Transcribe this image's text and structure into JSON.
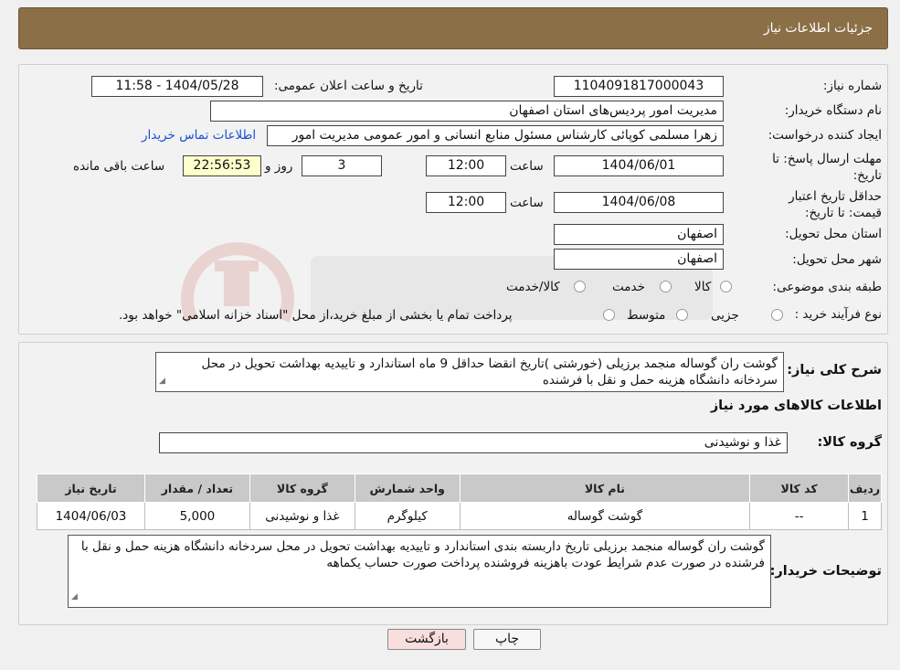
{
  "header": {
    "title": "جزئیات اطلاعات نیاز"
  },
  "fields": {
    "need_number_label": "شماره نیاز:",
    "need_number": "1104091817000043",
    "announce_label": "تاریخ و ساعت اعلان عمومی:",
    "announce_value": "1404/05/28 - 11:58",
    "buyer_org_label": "نام دستگاه خریدار:",
    "buyer_org": "مدیریت امور پردیس‌های استان اصفهان",
    "creator_label": "ایجاد کننده درخواست:",
    "creator": "زهرا مسلمی کوپائی کارشناس مسئول منابع انسانی و امور عمومی مدیریت امور",
    "contact_link": "اطلاعات تماس خریدار",
    "deadline_label": "مهلت ارسال پاسخ: تا تاریخ:",
    "deadline_date": "1404/06/01",
    "time_label": "ساعت",
    "deadline_time": "12:00",
    "days_value": "3",
    "days_label": "روز و",
    "remaining_time": "22:56:53",
    "remaining_label": "ساعت باقی مانده",
    "price_validity_label": "حداقل تاریخ اعتبار قیمت: تا تاریخ:",
    "price_validity_date": "1404/06/08",
    "price_validity_time": "12:00",
    "province_label": "استان محل تحویل:",
    "province": "اصفهان",
    "city_label": "شهر محل تحویل:",
    "city": "اصفهان",
    "category_label": "طبقه بندی موضوعی:",
    "category_options": [
      "کالا",
      "خدمت",
      "کالا/خدمت"
    ],
    "process_label": "نوع فرآیند خرید :",
    "process_options": [
      "جزیی",
      "متوسط"
    ],
    "process_note": "پرداخت تمام یا بخشی از مبلغ خرید،از محل \"اسناد خزانه اسلامی\" خواهد بود."
  },
  "summary": {
    "label": "شرح کلی نیاز:",
    "text": "گوشت ران گوساله منجمد برزیلی (خورشتی )تاریخ انقضا حداقل 9 ماه  استاندارد و تاییدیه بهداشت تحویل در محل سردخانه دانشگاه هزینه حمل و نقل با فرشنده"
  },
  "goods": {
    "section_title": "اطلاعات کالاهای مورد نیاز",
    "group_label": "گروه کالا:",
    "group_value": "غذا و نوشیدنی",
    "columns": [
      "ردیف",
      "کد کالا",
      "نام کالا",
      "واحد شمارش",
      "گروه کالا",
      "تعداد / مقدار",
      "تاریخ نیاز"
    ],
    "rows": [
      [
        "1",
        "--",
        "گوشت گوساله",
        "کیلوگرم",
        "غذا و نوشیدنی",
        "5,000",
        "1404/06/03"
      ]
    ]
  },
  "buyer_notes": {
    "label": "توضیحات خریدار:",
    "text": "گوشت ران گوساله منجمد برزیلی تاریخ داربسته بندی استاندارد و تاییدیه بهداشت تحویل در محل سردخانه دانشگاه هزینه حمل و نقل با فرشنده در صورت عدم شرایط عودت باهزینه فروشنده پرداخت صورت حساب یکماهه"
  },
  "buttons": {
    "print": "چاپ",
    "back": "بازگشت"
  },
  "colors": {
    "header_bg": "#8b6f47",
    "link": "#1a4fd6",
    "back_button_bg": "#f9dede",
    "table_header_bg": "#c9c9c9"
  }
}
